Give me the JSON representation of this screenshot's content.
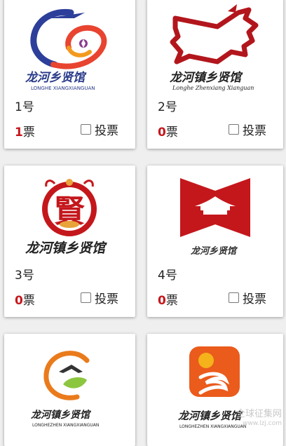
{
  "cards": [
    {
      "number": "1号",
      "votes": "1",
      "votes_unit": "票",
      "vote_label": "投票",
      "logo_title": "龙河乡贤馆",
      "logo_sub": "LONGHE XIANGXIANGUAN"
    },
    {
      "number": "2号",
      "votes": "0",
      "votes_unit": "票",
      "vote_label": "投票",
      "logo_title": "龙河镇乡贤馆",
      "logo_sub": "Longhe Zhenxiang Xianguan"
    },
    {
      "number": "3号",
      "votes": "0",
      "votes_unit": "票",
      "vote_label": "投票",
      "logo_title": "龙河镇乡贤馆",
      "logo_mark": "賢"
    },
    {
      "number": "4号",
      "votes": "0",
      "votes_unit": "票",
      "vote_label": "投票",
      "logo_title": "龙河乡贤馆"
    },
    {
      "logo_title": "龙河镇乡贤馆",
      "logo_sub": "LONGHEZHEN XIANGXIANGUAN"
    },
    {
      "logo_title": "龙河镇乡贤馆",
      "logo_sub": "LONGHEZHEN XIANGXIANGUAN"
    }
  ],
  "watermark": {
    "line1": "全球征集网",
    "line2": "www.lzj.com"
  },
  "colors": {
    "red": "#c4171c",
    "accent_blue": "#2c3f9a",
    "accent_orange": "#ea7b1c",
    "accent_green": "#8cc63f"
  }
}
